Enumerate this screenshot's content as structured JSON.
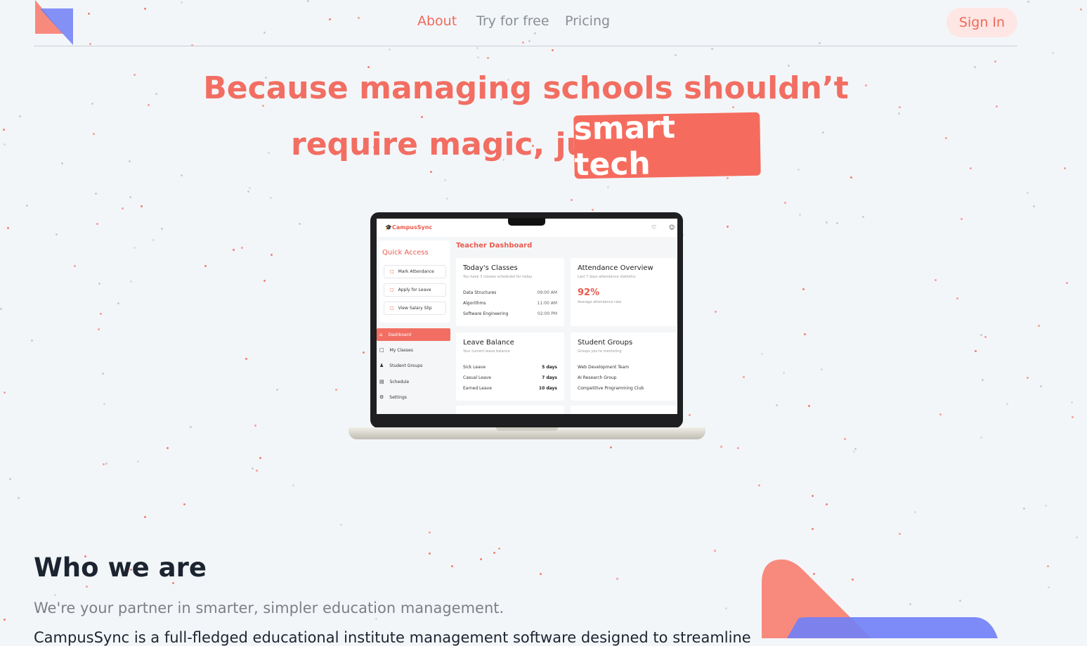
{
  "nav": {
    "about": "About",
    "try_free": "Try for free",
    "pricing": "Pricing",
    "sign_in": "Sign In"
  },
  "hero": {
    "line1": "Because managing schools shouldn’t",
    "line2": "require magic, just",
    "highlight": "smart tech"
  },
  "device": {
    "brand": "CampusSync",
    "quick_access": {
      "title": "Quick Access",
      "items": [
        "Mark Attendance",
        "Apply for Leave",
        "View Salary Slip"
      ]
    },
    "sidebar": [
      "Dashboard",
      "My Classes",
      "Student Groups",
      "Schedule",
      "Settings"
    ],
    "dashboard_title": "Teacher Dashboard",
    "todays_classes": {
      "title": "Today's Classes",
      "subtitle": "You have 3 classes scheduled for today",
      "rows": [
        {
          "name": "Data Structures",
          "time": "09:00 AM"
        },
        {
          "name": "Algorithms",
          "time": "11:00 AM"
        },
        {
          "name": "Software Engineering",
          "time": "02:00 PM"
        }
      ]
    },
    "attendance": {
      "title": "Attendance Overview",
      "subtitle": "Last 7 days attendance statistics",
      "value": "92%",
      "caption": "Average attendance rate"
    },
    "leave_balance": {
      "title": "Leave Balance",
      "subtitle": "Your current leave balance",
      "rows": [
        {
          "name": "Sick Leave",
          "days": "5 days"
        },
        {
          "name": "Casual Leave",
          "days": "7 days"
        },
        {
          "name": "Earned Leave",
          "days": "10 days"
        }
      ]
    },
    "student_groups": {
      "title": "Student Groups",
      "subtitle": "Groups you're mentoring",
      "groups": [
        "Web Development Team",
        "AI Research Group",
        "Competitive Programming Club"
      ]
    }
  },
  "who": {
    "title": "Who we are",
    "subtitle": "We're your partner in smarter, simpler education management.",
    "body": "CampusSync is a full-fledged educational institute management software designed to streamline"
  },
  "colors": {
    "accent": "#f26e62",
    "accent_light": "#fde6e4",
    "blue": "#6f7ff7",
    "background": "#f3f6f9"
  }
}
